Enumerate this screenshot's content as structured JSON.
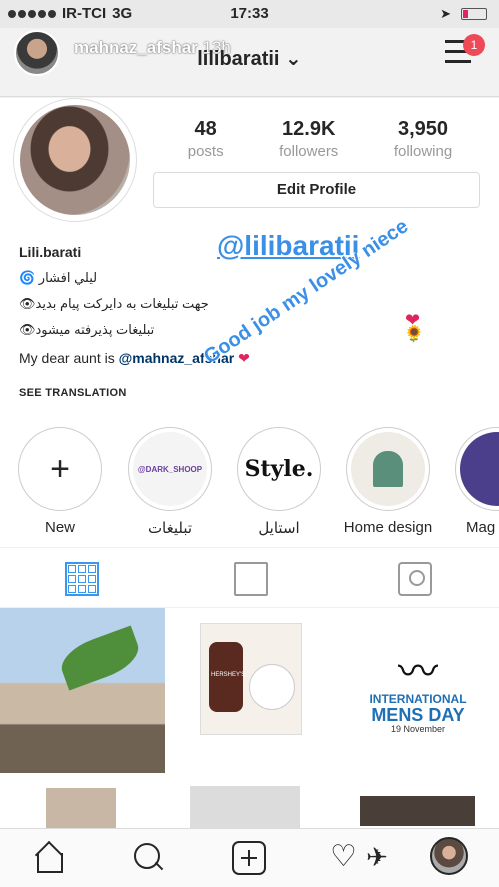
{
  "status_bar": {
    "carrier": "IR-TCI",
    "network": "3G",
    "time": "17:33"
  },
  "story": {
    "username": "mahnaz_afshar",
    "age": "13h"
  },
  "header": {
    "username": "lilibaratii ⌄",
    "notification_count": "1"
  },
  "profile": {
    "stats": [
      {
        "value": "48",
        "label": "posts"
      },
      {
        "value": "12.9K",
        "label": "followers"
      },
      {
        "value": "3,950",
        "label": "following"
      }
    ],
    "edit_button": "Edit Profile",
    "name": "Lili.barati",
    "bio_lines": [
      "ليلي افشار 🌀",
      "جهت تبليغات به دايركت پيام بديد👁",
      "تبليغات پذيرفته ميشود👁"
    ],
    "bio_aunt_prefix": "My dear aunt is ",
    "bio_aunt_mention": "@mahnaz_afshar",
    "bio_aunt_suffix": " ❤",
    "see_translation": "SEE TRANSLATION"
  },
  "stickers": {
    "handle": "@lilibaratii",
    "message": "Good job my lovely niece",
    "heart": "❤",
    "flower": "🌻"
  },
  "highlights": [
    {
      "label": "New",
      "icon": "plus-icon"
    },
    {
      "label": "تبليغات",
      "cover_text": "@DARK_SHOOP"
    },
    {
      "label": "استايل",
      "cover_text": "Style."
    },
    {
      "label": "Home design"
    },
    {
      "label": "Mag"
    }
  ],
  "posts": {
    "mens_day": {
      "line1": "INTERNATIONAL",
      "line2": "MENS DAY",
      "line3": "19 November"
    }
  },
  "colors": {
    "accent": "#3897f0",
    "sticker_blue": "#3a8fe7",
    "badge_red": "#ed4956"
  }
}
